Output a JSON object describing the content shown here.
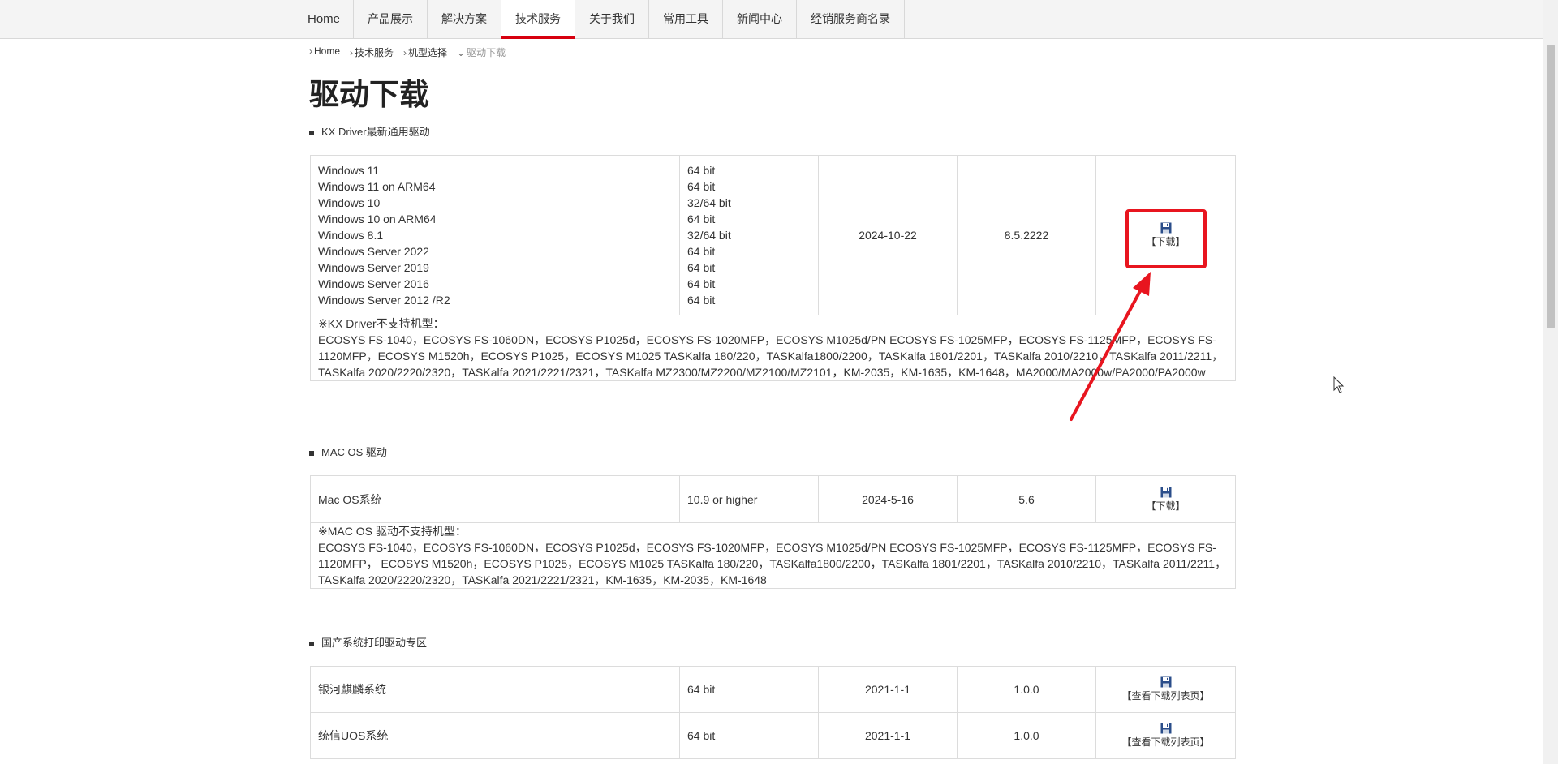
{
  "nav": {
    "items": [
      {
        "label": "Home"
      },
      {
        "label": "产品展示"
      },
      {
        "label": "解决方案"
      },
      {
        "label": "技术服务",
        "active": true
      },
      {
        "label": "关于我们"
      },
      {
        "label": "常用工具"
      },
      {
        "label": "新闻中心"
      },
      {
        "label": "经销服务商名录"
      }
    ]
  },
  "breadcrumb": [
    "Home",
    "技术服务",
    "机型选择",
    "驱动下载"
  ],
  "page_title": "驱动下载",
  "sections": {
    "kx": {
      "heading": "KX Driver最新通用驱动",
      "os_list": [
        "Windows 11",
        "Windows 11 on ARM64",
        "Windows 10",
        "Windows 10 on ARM64",
        "Windows 8.1",
        "Windows Server 2022",
        "Windows Server 2019",
        "Windows Server 2016",
        "Windows Server 2012 /R2"
      ],
      "bit_list": [
        "64 bit",
        "64 bit",
        "32/64 bit",
        "64 bit",
        "32/64 bit",
        "64 bit",
        "64 bit",
        "64 bit",
        "64 bit"
      ],
      "date": "2024-10-22",
      "version": "8.5.2222",
      "download_label": "【下载】",
      "note_title": "※KX Driver不支持机型：",
      "note_text": "ECOSYS FS-1040，ECOSYS FS-1060DN，ECOSYS P1025d，ECOSYS FS-1020MFP，ECOSYS M1025d/PN ECOSYS FS-1025MFP，ECOSYS FS-1125MFP，ECOSYS FS-1120MFP，ECOSYS M1520h，ECOSYS P1025，ECOSYS M1025 TASKalfa 180/220，TASKalfa1800/2200，TASKalfa 1801/2201，TASKalfa 2010/2210，TASKalfa 2011/2211，TASKalfa 2020/2220/2320，TASKalfa 2021/2221/2321，TASKalfa MZ2300/MZ2200/MZ2100/MZ2101，KM-2035，KM-1635，KM-1648，MA2000/MA2000w/PA2000/PA2000w"
    },
    "mac": {
      "heading": "MAC OS 驱动",
      "os": "Mac OS系统",
      "requirement": "10.9 or higher",
      "date": "2024-5-16",
      "version": "5.6",
      "download_label": "【下载】",
      "note_title": "※MAC OS 驱动不支持机型：",
      "note_text": "ECOSYS FS-1040，ECOSYS FS-1060DN，ECOSYS P1025d，ECOSYS FS-1020MFP，ECOSYS M1025d/PN ECOSYS FS-1025MFP，ECOSYS FS-1125MFP，ECOSYS FS-1120MFP， ECOSYS M1520h，ECOSYS P1025，ECOSYS M1025 TASKalfa 180/220，TASKalfa1800/2200，TASKalfa 1801/2201，TASKalfa 2010/2210，TASKalfa 2011/2211，TASKalfa 2020/2220/2320，TASKalfa 2021/2221/2321，KM-1635，KM-2035，KM-1648"
    },
    "domestic": {
      "heading": "国产系统打印驱动专区",
      "rows": [
        {
          "os": "银河麒麟系统",
          "bit": "64 bit",
          "date": "2021-1-1",
          "version": "1.0.0",
          "download_label": "【查看下载列表页】"
        },
        {
          "os": "统信UOS系统",
          "bit": "64 bit",
          "date": "2021-1-1",
          "version": "1.0.0",
          "download_label": "【查看下载列表页】"
        }
      ]
    }
  },
  "colors": {
    "accent": "#d7000f",
    "annotation": "#e8151f",
    "disk_icon": "#2a4d8a"
  }
}
